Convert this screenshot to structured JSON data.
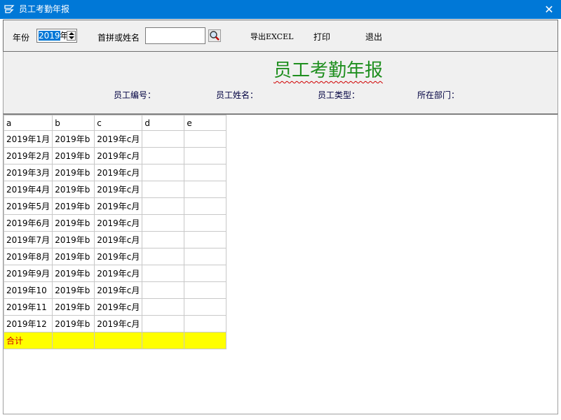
{
  "window": {
    "title": "员工考勤年报",
    "close_glyph": "✕",
    "icon": "app-logo-icon"
  },
  "toolbar": {
    "year_label": "年份",
    "year_value_selected": "2019",
    "year_value_suffix": "年",
    "search_label": "首拼或姓名",
    "search_value": "",
    "search_icon": "magnifier-icon",
    "export_label": "导出EXCEL",
    "print_label": "打印",
    "exit_label": "退出"
  },
  "report": {
    "title": "员工考勤年报",
    "employee_id_label": "员工编号：",
    "employee_name_label": "员工姓名：",
    "employee_type_label": "员工类型：",
    "department_label": "所在部门："
  },
  "grid": {
    "columns": [
      "a",
      "b",
      "c",
      "d",
      "e"
    ],
    "rows": [
      [
        "2019年1月",
        "2019年b",
        "2019年c月",
        "",
        ""
      ],
      [
        "2019年2月",
        "2019年b",
        "2019年c月",
        "",
        ""
      ],
      [
        "2019年3月",
        "2019年b",
        "2019年c月",
        "",
        ""
      ],
      [
        "2019年4月",
        "2019年b",
        "2019年c月",
        "",
        ""
      ],
      [
        "2019年5月",
        "2019年b",
        "2019年c月",
        "",
        ""
      ],
      [
        "2019年6月",
        "2019年b",
        "2019年c月",
        "",
        ""
      ],
      [
        "2019年7月",
        "2019年b",
        "2019年c月",
        "",
        ""
      ],
      [
        "2019年8月",
        "2019年b",
        "2019年c月",
        "",
        ""
      ],
      [
        "2019年9月",
        "2019年b",
        "2019年c月",
        "",
        ""
      ],
      [
        "2019年10",
        "2019年b",
        "2019年c月",
        "",
        ""
      ],
      [
        "2019年11",
        "2019年b",
        "2019年c月",
        "",
        ""
      ],
      [
        "2019年12",
        "2019年b",
        "2019年c月",
        "",
        ""
      ]
    ],
    "total_row": [
      "合计",
      "",
      "",
      "",
      ""
    ],
    "total_color": "#ffff00",
    "total_text_color": "#d00000"
  },
  "colors": {
    "titlebar": "#0078d7",
    "report_title": "#1f8f1f",
    "panel": "#f0f0f0"
  }
}
